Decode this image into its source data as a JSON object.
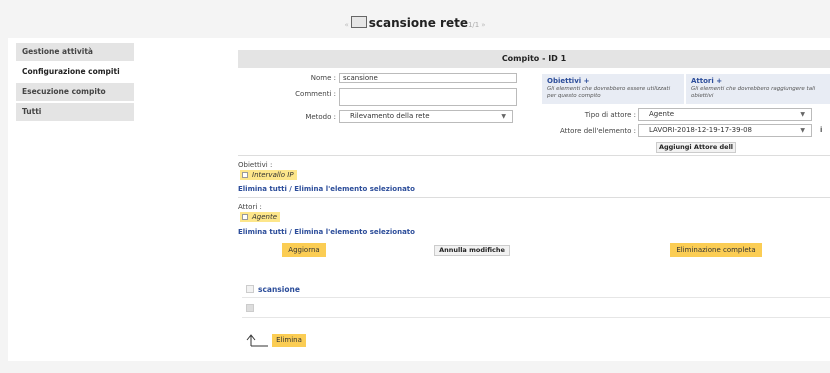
{
  "header": {
    "title": "scansione rete",
    "nav_prev": "«",
    "nav_next": "»",
    "page": "1/1"
  },
  "sidebar": {
    "items": [
      {
        "label": "Gestione attività"
      },
      {
        "label": "Configurazione compiti"
      },
      {
        "label": "Esecuzione compito"
      },
      {
        "label": "Tutti"
      }
    ]
  },
  "task": {
    "header": "Compito - ID 1",
    "name_label": "Nome :",
    "name_value": "scansione",
    "comments_label": "Commenti :",
    "method_label": "Metodo :",
    "method_value": "Rilevamento della rete",
    "objectives_box": {
      "title": "Obiettivi +",
      "desc": "Gli elementi che dovrebbero essere utilizzati per questo compito"
    },
    "actors_box": {
      "title": "Attori +",
      "desc": "Gli elementi che dovrebbero raggiungere tali obiettivi"
    },
    "actor_type_label": "Tipo di attore :",
    "actor_type_value": "Agente",
    "element_actor_label": "Attore dell'elemento :",
    "element_actor_value": "LAVORI-2018-12-19-17-39-08",
    "info_icon": "i",
    "add_actor_button": "Aggiungi Attore dell"
  },
  "objectives": {
    "label": "Obiettivi :",
    "item": "Intervallo IP",
    "links": "Elimina tutti / Elimina l'elemento selezionato"
  },
  "actors": {
    "label": "Attori :",
    "item": "Agente",
    "links": "Elimina tutti / Elimina l'elemento selezionato"
  },
  "actions": {
    "update": "Aggiorna",
    "cancel": "Annulla modifiche",
    "delete_all": "Eliminazione completa"
  },
  "list": {
    "rows": [
      {
        "label": "scansione"
      },
      {
        "label": ""
      }
    ]
  },
  "bottom": {
    "delete": "Elimina"
  }
}
